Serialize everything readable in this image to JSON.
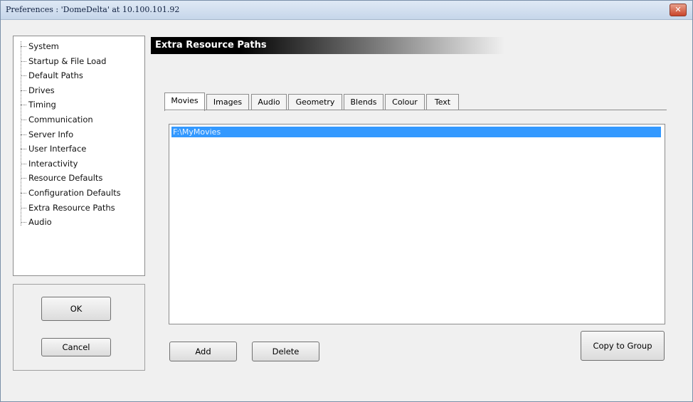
{
  "window": {
    "title": "Preferences  :  'DomeDelta'  at  10.100.101.92",
    "close_glyph": "✕"
  },
  "nav": {
    "items": [
      {
        "label": "System"
      },
      {
        "label": "Startup & File Load"
      },
      {
        "label": "Default Paths"
      },
      {
        "label": "Drives"
      },
      {
        "label": "Timing"
      },
      {
        "label": "Communication"
      },
      {
        "label": "Server Info"
      },
      {
        "label": "User Interface"
      },
      {
        "label": "Interactivity"
      },
      {
        "label": "Resource Defaults"
      },
      {
        "label": "Configuration Defaults"
      },
      {
        "label": "Extra Resource Paths"
      },
      {
        "label": "Audio"
      }
    ],
    "selected": "Extra Resource Paths"
  },
  "dialog_buttons": {
    "ok": "OK",
    "cancel": "Cancel"
  },
  "section": {
    "title": "Extra Resource Paths"
  },
  "tabs": [
    {
      "label": "Movies",
      "active": true
    },
    {
      "label": "Images"
    },
    {
      "label": "Audio"
    },
    {
      "label": "Geometry"
    },
    {
      "label": "Blends"
    },
    {
      "label": "Colour"
    },
    {
      "label": "Text"
    }
  ],
  "paths_list": {
    "items": [
      "F:\\MyMovies"
    ],
    "selected_index": 0
  },
  "actions": {
    "add": "Add",
    "delete": "Delete",
    "copy_to_group": "Copy to Group"
  },
  "colors": {
    "selection": "#3399ff",
    "header_bg": "#000000",
    "window_bg": "#f0f0f0"
  }
}
